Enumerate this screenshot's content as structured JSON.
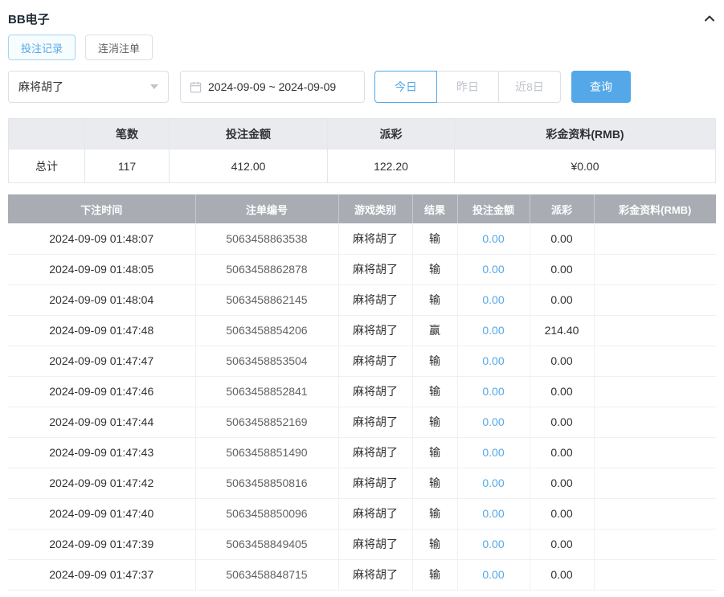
{
  "colors": {
    "accent": "#54a8e8",
    "table_header_bg": "#a9acb3"
  },
  "header": {
    "title": "BB电子"
  },
  "tabs": [
    {
      "label": "投注记录"
    },
    {
      "label": "连消注单"
    }
  ],
  "filters": {
    "game_select": {
      "value": "麻将胡了"
    },
    "date_range": {
      "value": "2024-09-09 ~ 2024-09-09"
    },
    "quick_buttons": [
      {
        "label": "今日"
      },
      {
        "label": "昨日"
      },
      {
        "label": "近8日"
      }
    ],
    "search_label": "查询"
  },
  "summary": {
    "headers": [
      "",
      "笔数",
      "投注金额",
      "派彩",
      "彩金资料(RMB)"
    ],
    "row_label": "总计",
    "values": [
      "117",
      "412.00",
      "122.20",
      "¥0.00"
    ]
  },
  "table": {
    "headers": [
      "下注时间",
      "注单编号",
      "游戏类别",
      "结果",
      "投注金额",
      "派彩",
      "彩金资料(RMB)"
    ],
    "rows": [
      {
        "time": "2024-09-09 01:48:07",
        "order_id": "5063458863538",
        "game": "麻将胡了",
        "result": "输",
        "bet": "0.00",
        "payout": "0.00",
        "bonus": ""
      },
      {
        "time": "2024-09-09 01:48:05",
        "order_id": "5063458862878",
        "game": "麻将胡了",
        "result": "输",
        "bet": "0.00",
        "payout": "0.00",
        "bonus": ""
      },
      {
        "time": "2024-09-09 01:48:04",
        "order_id": "5063458862145",
        "game": "麻将胡了",
        "result": "输",
        "bet": "0.00",
        "payout": "0.00",
        "bonus": ""
      },
      {
        "time": "2024-09-09 01:47:48",
        "order_id": "5063458854206",
        "game": "麻将胡了",
        "result": "赢",
        "bet": "0.00",
        "payout": "214.40",
        "bonus": ""
      },
      {
        "time": "2024-09-09 01:47:47",
        "order_id": "5063458853504",
        "game": "麻将胡了",
        "result": "输",
        "bet": "0.00",
        "payout": "0.00",
        "bonus": ""
      },
      {
        "time": "2024-09-09 01:47:46",
        "order_id": "5063458852841",
        "game": "麻将胡了",
        "result": "输",
        "bet": "0.00",
        "payout": "0.00",
        "bonus": ""
      },
      {
        "time": "2024-09-09 01:47:44",
        "order_id": "5063458852169",
        "game": "麻将胡了",
        "result": "输",
        "bet": "0.00",
        "payout": "0.00",
        "bonus": ""
      },
      {
        "time": "2024-09-09 01:47:43",
        "order_id": "5063458851490",
        "game": "麻将胡了",
        "result": "输",
        "bet": "0.00",
        "payout": "0.00",
        "bonus": ""
      },
      {
        "time": "2024-09-09 01:47:42",
        "order_id": "5063458850816",
        "game": "麻将胡了",
        "result": "输",
        "bet": "0.00",
        "payout": "0.00",
        "bonus": ""
      },
      {
        "time": "2024-09-09 01:47:40",
        "order_id": "5063458850096",
        "game": "麻将胡了",
        "result": "输",
        "bet": "0.00",
        "payout": "0.00",
        "bonus": ""
      },
      {
        "time": "2024-09-09 01:47:39",
        "order_id": "5063458849405",
        "game": "麻将胡了",
        "result": "输",
        "bet": "0.00",
        "payout": "0.00",
        "bonus": ""
      },
      {
        "time": "2024-09-09 01:47:37",
        "order_id": "5063458848715",
        "game": "麻将胡了",
        "result": "输",
        "bet": "0.00",
        "payout": "0.00",
        "bonus": ""
      }
    ]
  }
}
